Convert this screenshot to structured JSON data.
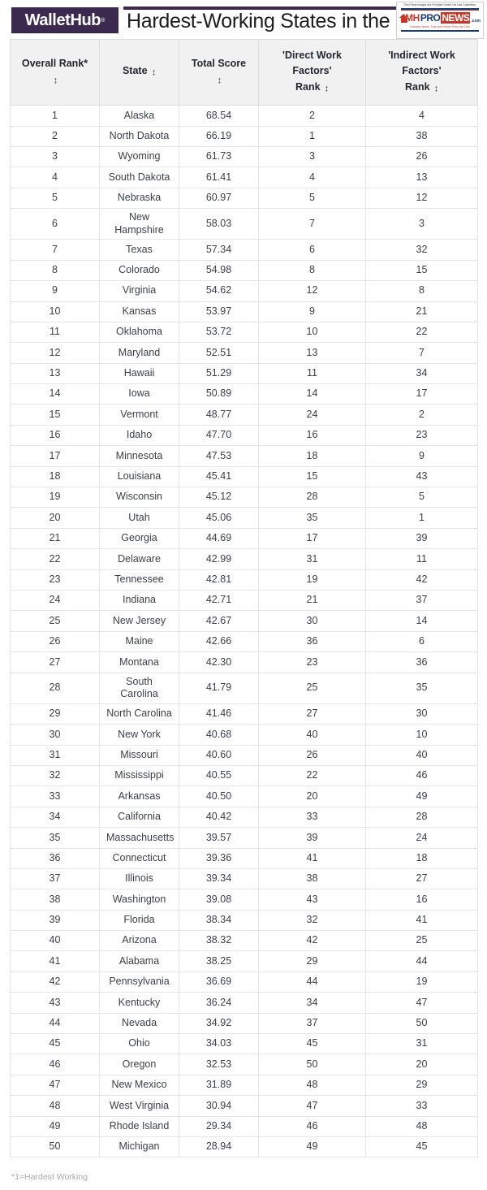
{
  "header": {
    "brand": "WalletHub",
    "brand_tm": "®",
    "title": "Hardest-Working States in the U.S.",
    "accent_color": "#3b2a4d"
  },
  "watermark": {
    "fair_use": "Third Party Images Are Provided Under Fair Use Guidelines.",
    "name_mh": "MH",
    "name_pro": "PRO",
    "name_news": "NEWS",
    "name_com": ".com",
    "tagline": "Industry News, Tips and Views Pros can Use",
    "red": "#c0392b",
    "blue": "#1b3a78"
  },
  "table": {
    "columns": [
      {
        "id": "overall_rank",
        "label": "Overall Rank*",
        "sort": "↕"
      },
      {
        "id": "state",
        "label": "State",
        "sort": "↕"
      },
      {
        "id": "total_score",
        "label": "Total Score",
        "sort": "↕"
      },
      {
        "id": "direct_work_factors_rank",
        "line1": "'Direct Work",
        "line2": "Factors'",
        "line3": "Rank",
        "sort": "↕"
      },
      {
        "id": "indirect_work_factors_rank",
        "line1": "'Indirect Work",
        "line2": "Factors'",
        "line3": "Rank",
        "sort": "↕"
      }
    ],
    "rows": [
      {
        "rank": "1",
        "state": "Alaska",
        "score": "68.54",
        "direct": "2",
        "indirect": "4"
      },
      {
        "rank": "2",
        "state": "North Dakota",
        "score": "66.19",
        "direct": "1",
        "indirect": "38"
      },
      {
        "rank": "3",
        "state": "Wyoming",
        "score": "61.73",
        "direct": "3",
        "indirect": "26"
      },
      {
        "rank": "4",
        "state": "South Dakota",
        "score": "61.41",
        "direct": "4",
        "indirect": "13"
      },
      {
        "rank": "5",
        "state": "Nebraska",
        "score": "60.97",
        "direct": "5",
        "indirect": "12"
      },
      {
        "rank": "6",
        "state": "New Hampshire",
        "score": "58.03",
        "direct": "7",
        "indirect": "3"
      },
      {
        "rank": "7",
        "state": "Texas",
        "score": "57.34",
        "direct": "6",
        "indirect": "32"
      },
      {
        "rank": "8",
        "state": "Colorado",
        "score": "54.98",
        "direct": "8",
        "indirect": "15"
      },
      {
        "rank": "9",
        "state": "Virginia",
        "score": "54.62",
        "direct": "12",
        "indirect": "8"
      },
      {
        "rank": "10",
        "state": "Kansas",
        "score": "53.97",
        "direct": "9",
        "indirect": "21"
      },
      {
        "rank": "11",
        "state": "Oklahoma",
        "score": "53.72",
        "direct": "10",
        "indirect": "22"
      },
      {
        "rank": "12",
        "state": "Maryland",
        "score": "52.51",
        "direct": "13",
        "indirect": "7"
      },
      {
        "rank": "13",
        "state": "Hawaii",
        "score": "51.29",
        "direct": "11",
        "indirect": "34"
      },
      {
        "rank": "14",
        "state": "Iowa",
        "score": "50.89",
        "direct": "14",
        "indirect": "17"
      },
      {
        "rank": "15",
        "state": "Vermont",
        "score": "48.77",
        "direct": "24",
        "indirect": "2"
      },
      {
        "rank": "16",
        "state": "Idaho",
        "score": "47.70",
        "direct": "16",
        "indirect": "23"
      },
      {
        "rank": "17",
        "state": "Minnesota",
        "score": "47.53",
        "direct": "18",
        "indirect": "9"
      },
      {
        "rank": "18",
        "state": "Louisiana",
        "score": "45.41",
        "direct": "15",
        "indirect": "43"
      },
      {
        "rank": "19",
        "state": "Wisconsin",
        "score": "45.12",
        "direct": "28",
        "indirect": "5"
      },
      {
        "rank": "20",
        "state": "Utah",
        "score": "45.06",
        "direct": "35",
        "indirect": "1"
      },
      {
        "rank": "21",
        "state": "Georgia",
        "score": "44.69",
        "direct": "17",
        "indirect": "39"
      },
      {
        "rank": "22",
        "state": "Delaware",
        "score": "42.99",
        "direct": "31",
        "indirect": "11"
      },
      {
        "rank": "23",
        "state": "Tennessee",
        "score": "42.81",
        "direct": "19",
        "indirect": "42"
      },
      {
        "rank": "24",
        "state": "Indiana",
        "score": "42.71",
        "direct": "21",
        "indirect": "37"
      },
      {
        "rank": "25",
        "state": "New Jersey",
        "score": "42.67",
        "direct": "30",
        "indirect": "14"
      },
      {
        "rank": "26",
        "state": "Maine",
        "score": "42.66",
        "direct": "36",
        "indirect": "6"
      },
      {
        "rank": "27",
        "state": "Montana",
        "score": "42.30",
        "direct": "23",
        "indirect": "36"
      },
      {
        "rank": "28",
        "state": "South Carolina",
        "score": "41.79",
        "direct": "25",
        "indirect": "35"
      },
      {
        "rank": "29",
        "state": "North Carolina",
        "score": "41.46",
        "direct": "27",
        "indirect": "30"
      },
      {
        "rank": "30",
        "state": "New York",
        "score": "40.68",
        "direct": "40",
        "indirect": "10"
      },
      {
        "rank": "31",
        "state": "Missouri",
        "score": "40.60",
        "direct": "26",
        "indirect": "40"
      },
      {
        "rank": "32",
        "state": "Mississippi",
        "score": "40.55",
        "direct": "22",
        "indirect": "46"
      },
      {
        "rank": "33",
        "state": "Arkansas",
        "score": "40.50",
        "direct": "20",
        "indirect": "49"
      },
      {
        "rank": "34",
        "state": "California",
        "score": "40.42",
        "direct": "33",
        "indirect": "28"
      },
      {
        "rank": "35",
        "state": "Massachusetts",
        "score": "39.57",
        "direct": "39",
        "indirect": "24"
      },
      {
        "rank": "36",
        "state": "Connecticut",
        "score": "39.36",
        "direct": "41",
        "indirect": "18"
      },
      {
        "rank": "37",
        "state": "Illinois",
        "score": "39.34",
        "direct": "38",
        "indirect": "27"
      },
      {
        "rank": "38",
        "state": "Washington",
        "score": "39.08",
        "direct": "43",
        "indirect": "16"
      },
      {
        "rank": "39",
        "state": "Florida",
        "score": "38.34",
        "direct": "32",
        "indirect": "41"
      },
      {
        "rank": "40",
        "state": "Arizona",
        "score": "38.32",
        "direct": "42",
        "indirect": "25"
      },
      {
        "rank": "41",
        "state": "Alabama",
        "score": "38.25",
        "direct": "29",
        "indirect": "44"
      },
      {
        "rank": "42",
        "state": "Pennsylvania",
        "score": "36.69",
        "direct": "44",
        "indirect": "19"
      },
      {
        "rank": "43",
        "state": "Kentucky",
        "score": "36.24",
        "direct": "34",
        "indirect": "47"
      },
      {
        "rank": "44",
        "state": "Nevada",
        "score": "34.92",
        "direct": "37",
        "indirect": "50"
      },
      {
        "rank": "45",
        "state": "Ohio",
        "score": "34.03",
        "direct": "45",
        "indirect": "31"
      },
      {
        "rank": "46",
        "state": "Oregon",
        "score": "32.53",
        "direct": "50",
        "indirect": "20"
      },
      {
        "rank": "47",
        "state": "New Mexico",
        "score": "31.89",
        "direct": "48",
        "indirect": "29"
      },
      {
        "rank": "48",
        "state": "West Virginia",
        "score": "30.94",
        "direct": "47",
        "indirect": "33"
      },
      {
        "rank": "49",
        "state": "Rhode Island",
        "score": "29.34",
        "direct": "46",
        "indirect": "48"
      },
      {
        "rank": "50",
        "state": "Michigan",
        "score": "28.94",
        "direct": "49",
        "indirect": "45"
      }
    ]
  },
  "footnote": "*1=Hardest Working"
}
